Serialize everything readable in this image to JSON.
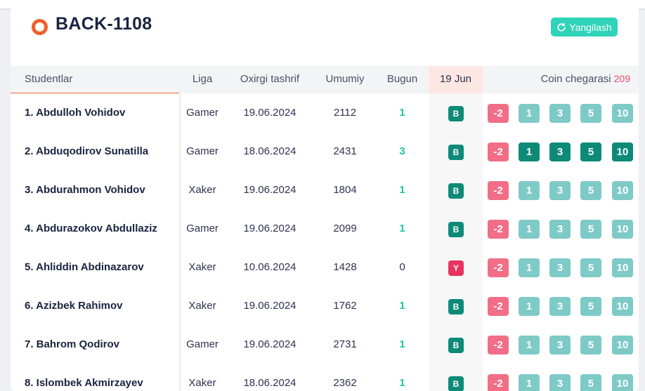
{
  "group": {
    "title": "BACK-1108",
    "refresh_label": "Yangilash"
  },
  "columns": {
    "students": "Studentlar",
    "league": "Liga",
    "last_visit": "Oxirgi tashrif",
    "total": "Umumiy",
    "today": "Bugun",
    "date": "19 Jun",
    "coin_limit": "Coin chegarasi",
    "coin_limit_value": "209"
  },
  "colors": {
    "accent": "#f0602a",
    "teal": "#2fd3b9",
    "present": "#0e8a79",
    "absent": "#e8325f",
    "neg_coin": "#f16e86",
    "coin_light": "#7ecac7",
    "coin_dark": "#0e8a79"
  },
  "coin_buttons": [
    "-2",
    "1",
    "3",
    "5",
    "10"
  ],
  "students": [
    {
      "name": "1. Abdulloh Vohidov",
      "league": "Gamer",
      "last_visit": "19.06.2024",
      "total": "2112",
      "today": "1",
      "attendance": "B",
      "coins_selected": false
    },
    {
      "name": "2. Abduqodirov Sunatilla",
      "league": "Gamer",
      "last_visit": "18.06.2024",
      "total": "2431",
      "today": "3",
      "attendance": "B",
      "coins_selected": true
    },
    {
      "name": "3. Abdurahmon Vohidov",
      "league": "Xaker",
      "last_visit": "19.06.2024",
      "total": "1804",
      "today": "1",
      "attendance": "B",
      "coins_selected": false
    },
    {
      "name": "4. Abdurazokov Abdullaziz",
      "league": "Gamer",
      "last_visit": "19.06.2024",
      "total": "2099",
      "today": "1",
      "attendance": "B",
      "coins_selected": false
    },
    {
      "name": "5. Ahliddin Abdinazarov",
      "league": "Xaker",
      "last_visit": "10.06.2024",
      "total": "1428",
      "today": "0",
      "attendance": "Y",
      "coins_selected": false
    },
    {
      "name": "6. Azizbek Rahimov",
      "league": "Xaker",
      "last_visit": "19.06.2024",
      "total": "1762",
      "today": "1",
      "attendance": "B",
      "coins_selected": false
    },
    {
      "name": "7. Bahrom Qodirov",
      "league": "Gamer",
      "last_visit": "19.06.2024",
      "total": "2731",
      "today": "1",
      "attendance": "B",
      "coins_selected": false
    },
    {
      "name": "8. Islombek Akmirzayev",
      "league": "Xaker",
      "last_visit": "18.06.2024",
      "total": "2362",
      "today": "1",
      "attendance": "B",
      "coins_selected": false
    }
  ]
}
